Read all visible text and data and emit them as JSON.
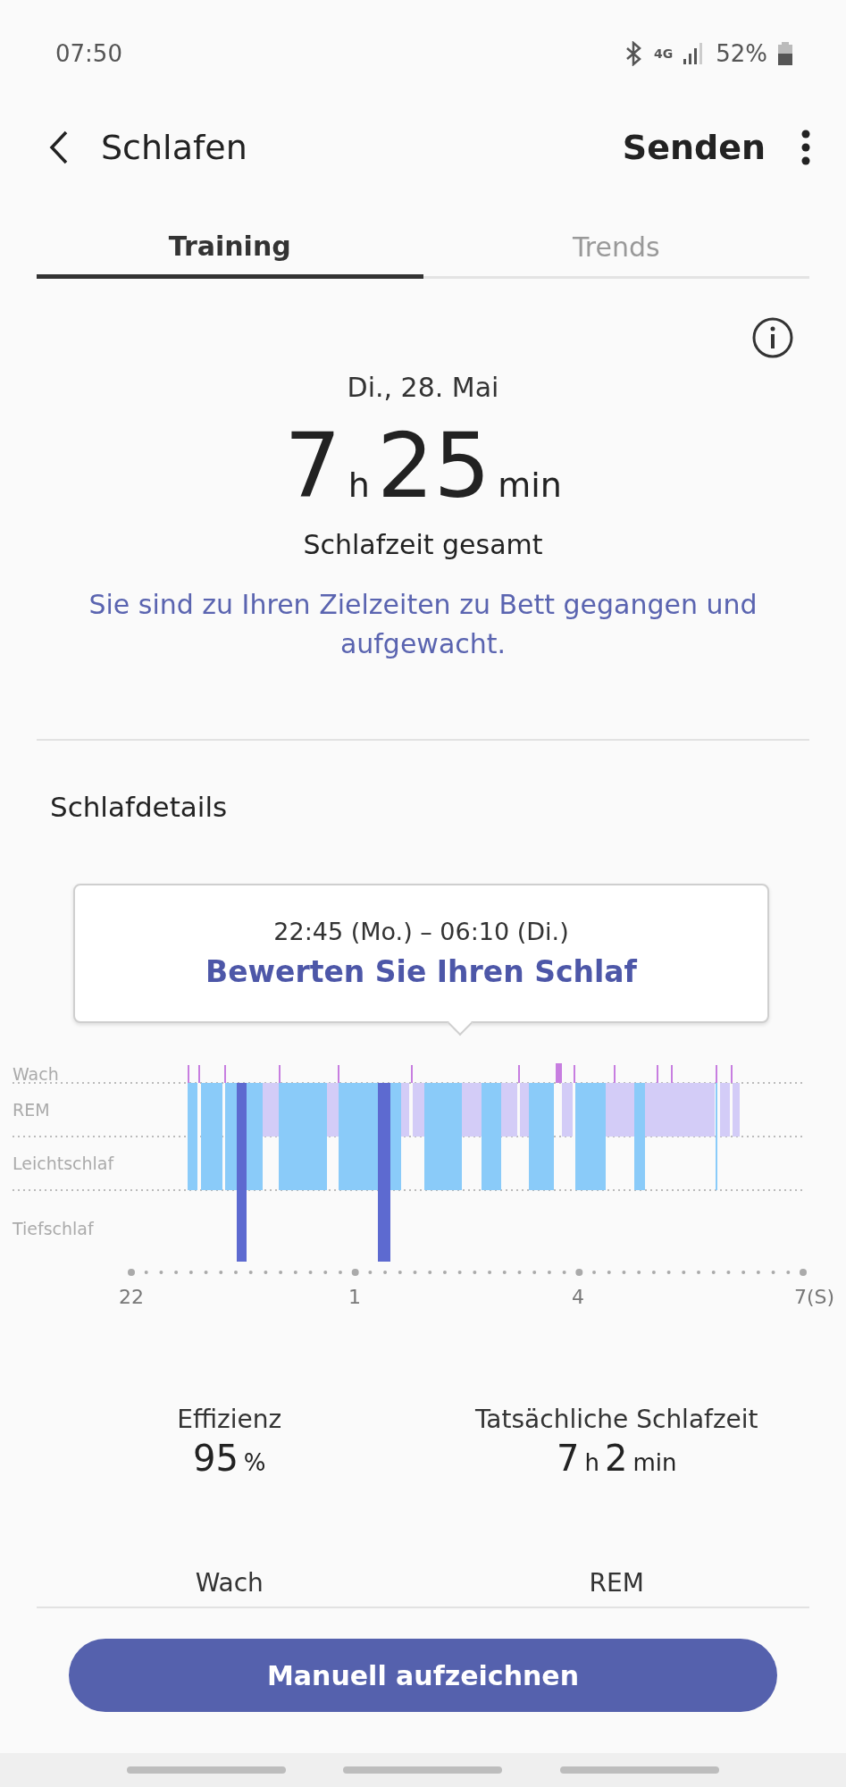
{
  "status_bar": {
    "time": "07:50",
    "network": "4G",
    "battery": "52%"
  },
  "header": {
    "title": "Schlafen",
    "action": "Senden"
  },
  "tabs": [
    {
      "label": "Training",
      "selected": true
    },
    {
      "label": "Trends",
      "selected": false
    }
  ],
  "summary": {
    "date": "Di., 28. Mai",
    "duration": [
      {
        "text": "7",
        "kind": "number"
      },
      {
        "text": "h",
        "kind": "unit"
      },
      {
        "text": "25",
        "kind": "number"
      },
      {
        "text": "min",
        "kind": "unit"
      }
    ],
    "label": "Schlafzeit gesamt",
    "message": "Sie sind zu Ihren Zielzeiten zu Bett gegangen und aufgewacht."
  },
  "details": {
    "title": "Schlafdetails",
    "popup": {
      "range": "22:45 (Mo.) – 06:10 (Di.)",
      "link": "Bewerten Sie Ihren Schlaf"
    },
    "sleep_chart": {
      "stage_labels": [
        "Wach",
        "REM",
        "Leichtschlaf",
        "Tiefschlaf"
      ],
      "time_labels": [
        "22",
        "1",
        "4",
        "7(S)"
      ]
    }
  },
  "stats": [
    {
      "label": "Effizienz",
      "value": [
        {
          "text": "95",
          "kind": "number"
        },
        {
          "text": "%",
          "kind": "unit"
        }
      ]
    },
    {
      "label": "Tatsächliche Schlafzeit",
      "value": [
        {
          "text": "7",
          "kind": "number"
        },
        {
          "text": "h",
          "kind": "unit"
        },
        {
          "text": "2",
          "kind": "number"
        },
        {
          "text": "min",
          "kind": "unit"
        }
      ]
    }
  ],
  "stage_headers": [
    "Wach",
    "REM"
  ],
  "button": "Manuell aufzeichnen"
}
